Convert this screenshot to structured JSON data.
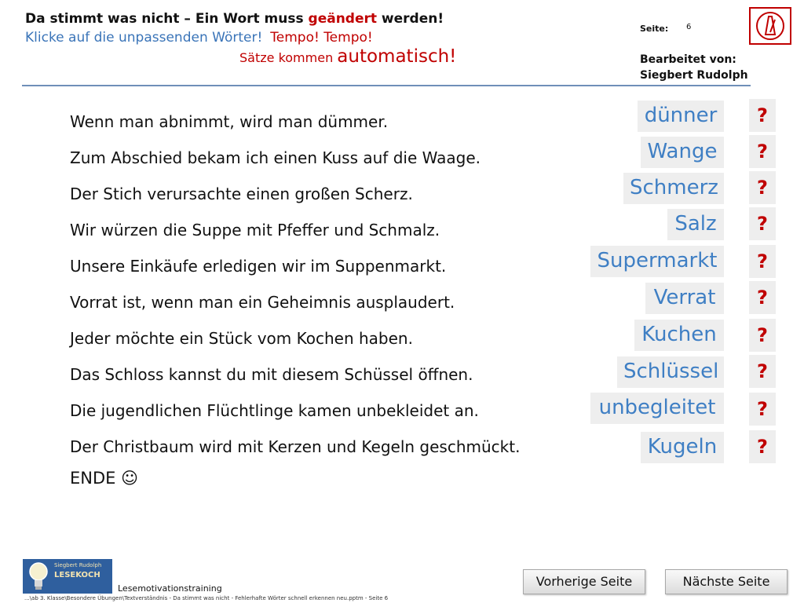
{
  "header": {
    "title_part1": "Da stimmt was nicht – Ein Wort muss ",
    "title_highlight": "geändert",
    "title_part3": " werden!",
    "instruction": "Klicke auf die unpassenden Wörter!",
    "tempo": "Tempo! Tempo!",
    "auto_small": "Sätze kommen ",
    "auto_big": "automatisch!"
  },
  "page_info": {
    "seite_label": "Seite:",
    "seite_number": "6",
    "author_line1": "Bearbeitet  von:",
    "author_line2": "Siegbert  Rudolph"
  },
  "sentences": [
    "Wenn man abnimmt, wird man dümmer.",
    "Zum Abschied bekam ich einen Kuss auf die Waage.",
    "Der Stich verursachte einen großen Scherz.",
    "Wir würzen die Suppe mit Pfeffer und Schmalz.",
    "Unsere Einkäufe erledigen wir im Suppenmarkt.",
    "Vorrat ist, wenn man ein Geheimnis ausplaudert.",
    "Jeder möchte ein Stück vom Kochen haben.",
    "Das Schloss kannst du mit diesem Schüssel öffnen.",
    "Die jugendlichen Flüchtlinge kamen unbekleidet an.",
    "Der Christbaum wird mit Kerzen und Kegeln geschmückt."
  ],
  "ende": "ENDE ☺",
  "corrections": [
    "dünner",
    "Wange",
    "Schmerz",
    "Salz",
    "Supermarkt",
    "Verrat",
    "Kuchen",
    "Schlüssel",
    "unbegleitet",
    "Kugeln"
  ],
  "help_button": "?",
  "footer": {
    "logo_line1": "Siegbert Rudolph",
    "logo_line2": "LESEKOCH",
    "label": "Lesemotivationstraining",
    "path": "...\\ab 3. Klasse\\Besondere Übungen\\Textverständnis - Da stimmt was nicht - Fehlerhafte Wörter schnell erkennen neu.pptm - Seite 6",
    "prev_button": "Vorherige Seite",
    "next_button": "Nächste Seite"
  },
  "colors": {
    "accent_blue": "#3a74b8",
    "alert_red": "#c00000",
    "word_box": "#eeeeee"
  }
}
